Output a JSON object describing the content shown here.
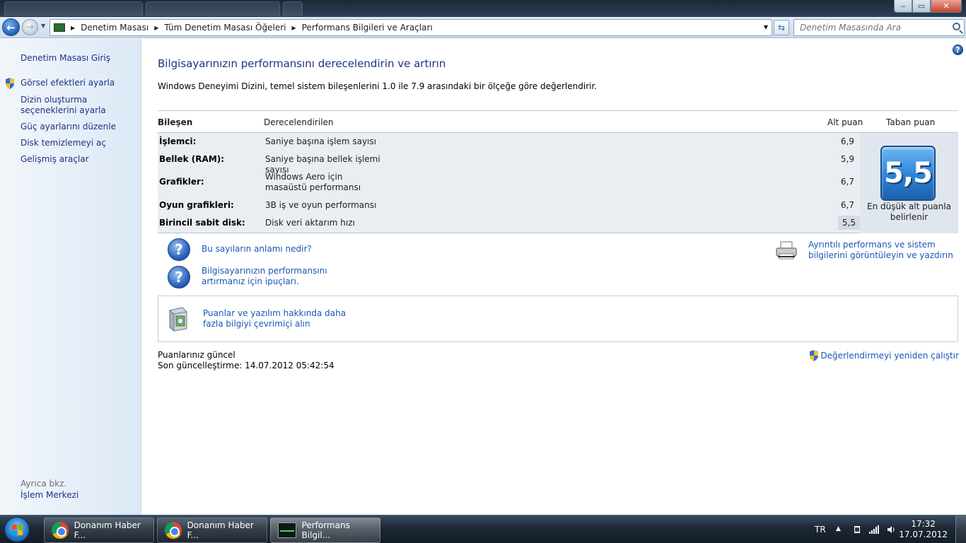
{
  "window": {
    "caption_min": "‒",
    "caption_max": "▭",
    "caption_close": "✕"
  },
  "nav": {
    "back_glyph": "←",
    "fwd_glyph": "→",
    "refresh_glyph": "⇆",
    "breadcrumbs": [
      "Denetim Masası",
      "Tüm Denetim Masası Öğeleri",
      "Performans Bilgileri ve Araçları"
    ],
    "search_placeholder": "Denetim Masasında Ara"
  },
  "sidebar": {
    "items": [
      {
        "label": "Denetim Masası Giriş"
      },
      {
        "label": "Görsel efektleri ayarla"
      },
      {
        "label": "Dizin oluşturma seçeneklerini ayarla"
      },
      {
        "label": "Güç ayarlarını düzenle"
      },
      {
        "label": "Disk temizlemeyi aç"
      },
      {
        "label": "Gelişmiş araçlar"
      }
    ],
    "see_also_heading": "Ayrıca bkz.",
    "see_also_items": [
      {
        "label": "İşlem Merkezi"
      }
    ]
  },
  "main": {
    "title": "Bilgisayarınızın performansını derecelendirin ve artırın",
    "description": "Windows Deneyimi Dizini, temel sistem bileşenlerini 1.0 ile 7.9 arasındaki bir ölçeğe göre değerlendirir.",
    "table": {
      "headers": {
        "component": "Bileşen",
        "rated": "Derecelendirilen",
        "subscore": "Alt puan",
        "basescore": "Taban puan"
      },
      "rows": [
        {
          "component": "İşlemci:",
          "rated": "Saniye başına işlem sayısı",
          "subscore": "6,9"
        },
        {
          "component": "Bellek (RAM):",
          "rated": "Saniye başına bellek işlemi sayısı",
          "subscore": "5,9"
        },
        {
          "component": "Grafikler:",
          "rated": "Windows Aero için masaüstü performansı",
          "subscore": "6,7"
        },
        {
          "component": "Oyun grafikleri:",
          "rated": "3B iş ve oyun performansı",
          "subscore": "6,7"
        },
        {
          "component": "Birincil sabit disk:",
          "rated": "Disk veri aktarım hızı",
          "subscore": "5,5"
        }
      ],
      "base_score": "5,5",
      "base_caption": "En düşük alt puanla belirlenir"
    },
    "links": {
      "meaning": "Bu sayıların anlamı nedir?",
      "tips": "Bilgisayarınızın performansını artırmanız için ipuçları.",
      "detailed": "Ayrıntılı performans ve sistem bilgilerini görüntüleyin ve yazdırın",
      "online": "Puanlar ve yazılım hakkında daha fazla bilgiyi çevrimiçi alın",
      "rerun": "Değerlendirmeyi yeniden çalıştır"
    },
    "status": {
      "current": "Puanlarınız güncel",
      "last_update": "Son güncelleştirme: 14.07.2012 05:42:54"
    }
  },
  "taskbar": {
    "items": [
      {
        "label": "Donanım Haber F..."
      },
      {
        "label": "Donanım Haber F..."
      },
      {
        "label": "Performans Bilgil..."
      }
    ],
    "lang": "TR",
    "time": "17:32",
    "date": "17.07.2012"
  },
  "colors": {
    "link": "#1a56b4",
    "sidebar_link": "#1e3287",
    "title": "#1e3287",
    "badge": "#2c83d9"
  }
}
